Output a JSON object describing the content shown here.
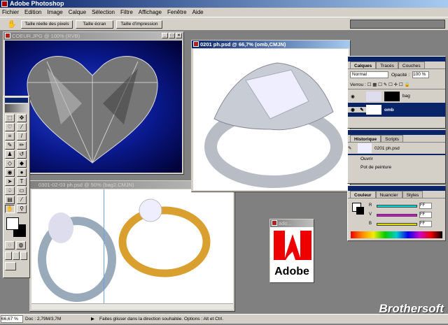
{
  "app": {
    "title": "Adobe Photoshop"
  },
  "menu": [
    "Fichier",
    "Edition",
    "Image",
    "Calque",
    "Sélection",
    "Filtre",
    "Affichage",
    "Fenêtre",
    "Aide"
  ],
  "options": {
    "buttons": [
      "Taille réelle des pixels",
      "Taille écran",
      "Taille d'impression"
    ]
  },
  "documents": {
    "coeur": {
      "title": "COEUR.JPG @ 100% (RVB)"
    },
    "ring": {
      "title": "0201 ph.psd @ 66,7% (omb,CMJN)"
    },
    "rings2": {
      "title": "0301-02-03 ph.psd @ 50% (bag2,CMJN)"
    },
    "adobe": {
      "title": "ado...",
      "logo_text": "Adobe"
    }
  },
  "layers": {
    "tabs": [
      "Calques",
      "Tracés",
      "Couches"
    ],
    "blend_mode": "Normal",
    "opacity_label": "Opacité :",
    "opacity": "100 %",
    "lock_label": "Verrou :",
    "items": [
      {
        "name": "bag"
      },
      {
        "name": "omb"
      }
    ]
  },
  "history": {
    "tabs": [
      "Historique",
      "Scripts"
    ],
    "snapshot": "0201 ph.psd",
    "items": [
      "Ouvrir",
      "Pot de peinture"
    ]
  },
  "color": {
    "tabs": [
      "Couleur",
      "Nuancier",
      "Styles"
    ],
    "channels": [
      {
        "label": "R",
        "value": "FF",
        "color": "#00e0e0"
      },
      {
        "label": "V",
        "value": "FF",
        "color": "#e000e0"
      },
      {
        "label": "B",
        "value": "FF",
        "color": "#e0e000"
      }
    ]
  },
  "status": {
    "zoom": "66,67 %",
    "doc": "Doc : 2,79M/3,7M",
    "hint": "Faites glisser dans la direction souhaitée. Options : Alt et Ctrl."
  },
  "watermark": "Brothersoft"
}
